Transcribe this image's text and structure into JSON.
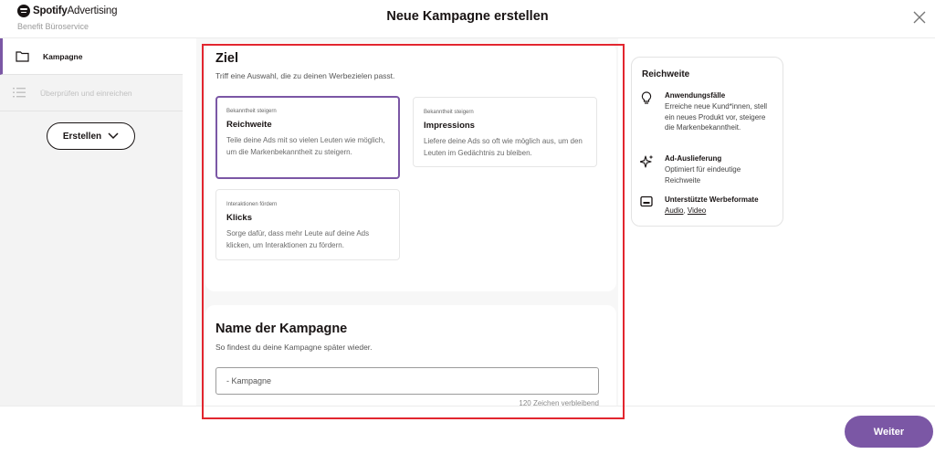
{
  "header": {
    "brand_bold": "Spotify",
    "brand_light": "Advertising",
    "account_name": "Benefit Büroservice",
    "title": "Neue Kampagne erstellen",
    "close_icon": "close-icon"
  },
  "sidebar": {
    "items": [
      {
        "label": "Kampagne",
        "icon": "folder-icon",
        "state": "active"
      },
      {
        "label": "Überprüfen und einreichen",
        "icon": "list-icon",
        "state": "disabled"
      }
    ],
    "create_button": "Erstellen"
  },
  "goal": {
    "title": "Ziel",
    "subtitle": "Triff eine Auswahl, die zu deinen Werbezielen passt.",
    "options": [
      {
        "category": "Bekanntheit steigern",
        "title": "Reichweite",
        "description": "Teile deine Ads mit so vielen Leuten wie möglich, um die Markenbekanntheit zu steigern.",
        "selected": true
      },
      {
        "category": "Bekanntheit steigern",
        "title": "Impressions",
        "description": "Liefere deine Ads so oft wie möglich aus, um den Leuten im Gedächtnis zu bleiben.",
        "selected": false
      },
      {
        "category": "Interaktionen fördern",
        "title": "Klicks",
        "description": "Sorge dafür, dass mehr Leute auf deine Ads klicken, um Interaktionen zu fördern.",
        "selected": false
      }
    ]
  },
  "campaign_name": {
    "title": "Name der Kampagne",
    "subtitle": "So findest du deine Kampagne später wieder.",
    "value": "- Kampagne",
    "char_count": "120 Zeichen verbleibend"
  },
  "info_panel": {
    "title": "Reichweite",
    "rows": [
      {
        "icon": "lightbulb-icon",
        "heading": "Anwendungsfälle",
        "text": "Erreiche neue Kund*innen, stell ein neues Produkt vor, steigere die Markenbekanntheit."
      },
      {
        "icon": "sparkle-icon",
        "heading": "Ad-Auslieferung",
        "text": "Optimiert für eindeutige Reichweite"
      },
      {
        "icon": "display-icon",
        "heading": "Unterstützte Werbeformate",
        "link_1": "Audio",
        "separator": ", ",
        "link_2": "Video"
      }
    ]
  },
  "footer": {
    "next_button": "Weiter"
  },
  "colors": {
    "accent": "#7b57a5",
    "highlight": "#e2262f",
    "sidebar_bg": "#f3f3f3"
  }
}
